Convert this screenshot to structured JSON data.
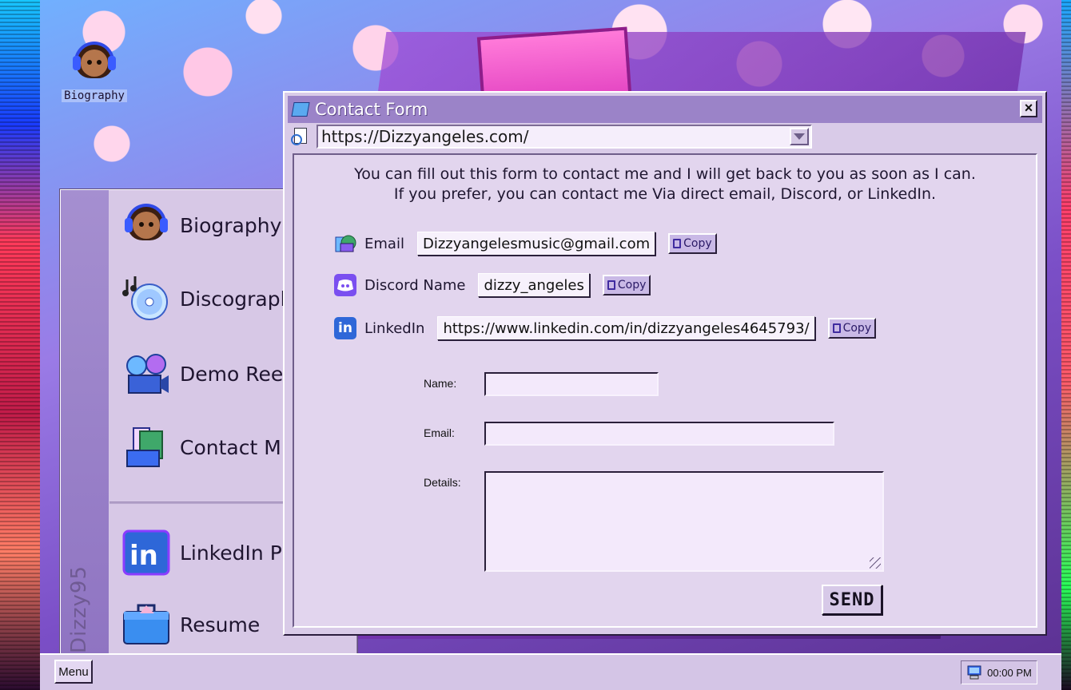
{
  "desktop": {
    "icon_label": "Biography"
  },
  "start_menu": {
    "brand": "Dizzy95",
    "items": [
      {
        "label": "Biography",
        "icon": "avatar-icon"
      },
      {
        "label": "Discograph",
        "icon": "cd-music-icon"
      },
      {
        "label": "Demo Reel",
        "icon": "film-reel-icon"
      },
      {
        "label": "Contact M",
        "icon": "contact-book-icon"
      },
      {
        "label": "LinkedIn PF",
        "icon": "linkedin-icon"
      },
      {
        "label": "Resume",
        "icon": "briefcase-icon"
      }
    ]
  },
  "window": {
    "title": "Contact Form",
    "close": "×",
    "address": "https://Dizzyangeles.com/",
    "intro_line1": "You can fill out this form to contact me and I will get back to you as soon as I can.",
    "intro_line2": "If you prefer, you can contact me Via direct email, Discord, or LinkedIn.",
    "contacts": [
      {
        "label": "Email",
        "value": "Dizzyangelesmusic@gmail.com",
        "copy": "Copy"
      },
      {
        "label": "Discord Name",
        "value": "dizzy_angeles",
        "copy": "Copy"
      },
      {
        "label": "LinkedIn",
        "value": "https://www.linkedin.com/in/dizzyangeles4645793/",
        "copy": "Copy"
      }
    ],
    "form": {
      "name_label": "Name:",
      "email_label": "Email:",
      "details_label": "Details:",
      "send": "SEND"
    }
  },
  "taskbar": {
    "menu": "Menu",
    "clock": "00:00 PM"
  },
  "colors": {
    "accent": "#9b83c8",
    "window_bg": "#d9cbe8",
    "linkedin": "#2e67d8",
    "discord": "#7a4ff0"
  }
}
